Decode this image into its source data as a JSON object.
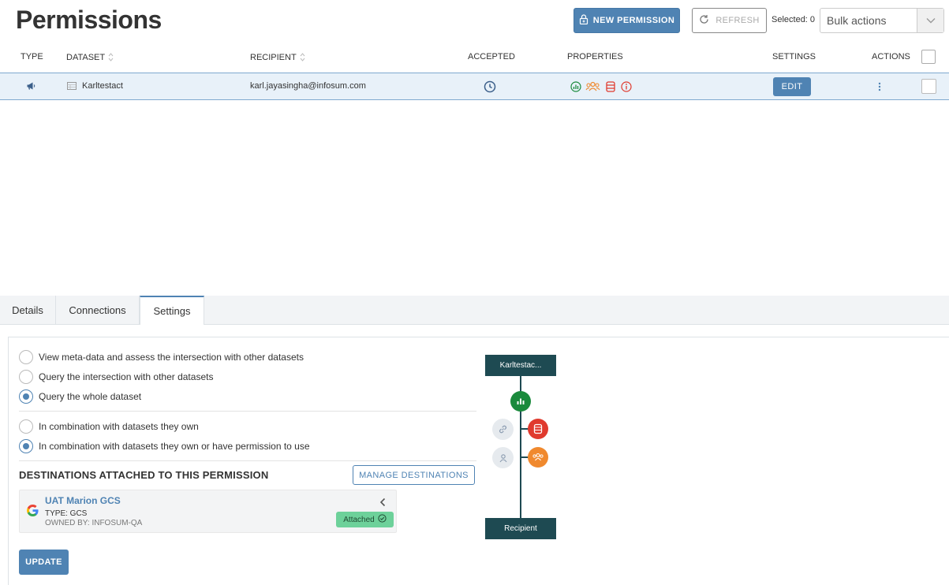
{
  "header": {
    "title": "Permissions",
    "new_permission_label": "NEW PERMISSION",
    "refresh_label": "REFRESH",
    "selected_label": "Selected: 0",
    "bulk_actions": "Bulk actions"
  },
  "table": {
    "columns": {
      "type": "TYPE",
      "dataset": "DATASET",
      "recipient": "RECIPIENT",
      "accepted": "ACCEPTED",
      "properties": "PROPERTIES",
      "settings": "SETTINGS",
      "actions": "ACTIONS"
    },
    "rows": [
      {
        "dataset": "Karltestact",
        "recipient": "karl.jayasingha@infosum.com",
        "edit_label": "EDIT"
      }
    ]
  },
  "tabs": [
    {
      "label": "Details"
    },
    {
      "label": "Connections"
    },
    {
      "label": "Settings"
    }
  ],
  "settings": {
    "access_options": [
      {
        "label": "View meta-data and assess the intersection with other datasets",
        "checked": false
      },
      {
        "label": "Query the intersection with other datasets",
        "checked": false
      },
      {
        "label": "Query the whole dataset",
        "checked": true
      }
    ],
    "combination_options": [
      {
        "label": "In combination with datasets they own",
        "checked": false
      },
      {
        "label": "In combination with datasets they own or have permission to use",
        "checked": true
      }
    ],
    "destinations_title": "DESTINATIONS ATTACHED TO THIS PERMISSION",
    "manage_destinations_label": "MANAGE DESTINATIONS",
    "destination": {
      "name": "UAT Marion GCS",
      "type": "TYPE: GCS",
      "owner": "OWNED BY: INFOSUM-QA",
      "status": "Attached"
    },
    "update_label": "UPDATE"
  },
  "diagram": {
    "top_label": "Karltestac...",
    "bottom_label": "Recipient"
  },
  "colors": {
    "primary": "#4f83b3",
    "diagram_dark": "#1e4a52",
    "green": "#1a8a3c",
    "red": "#e03a2e",
    "orange": "#f0892e",
    "attached_bg": "#6dd19a"
  }
}
